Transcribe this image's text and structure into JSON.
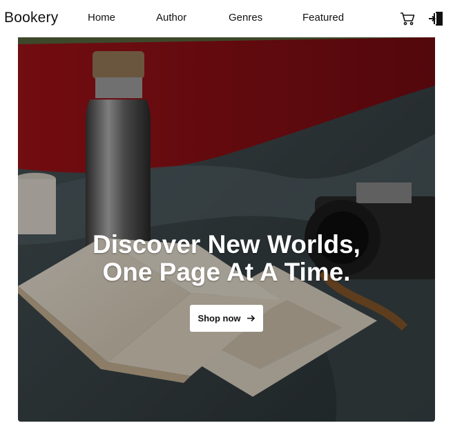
{
  "nav": {
    "brand": "Bookery",
    "links": [
      "Home",
      "Author",
      "Genres",
      "Featured"
    ],
    "icons": [
      "cart-icon",
      "login-icon"
    ]
  },
  "hero": {
    "title_line1": "Discover New Worlds,",
    "title_line2": "One Page At A Time.",
    "cta_label": "Shop now",
    "cta_icon": "arrow-right-icon",
    "overlay_color": "#000000"
  },
  "colors": {
    "text": "#111111",
    "background": "#ffffff",
    "cta_background": "#ffffff"
  }
}
